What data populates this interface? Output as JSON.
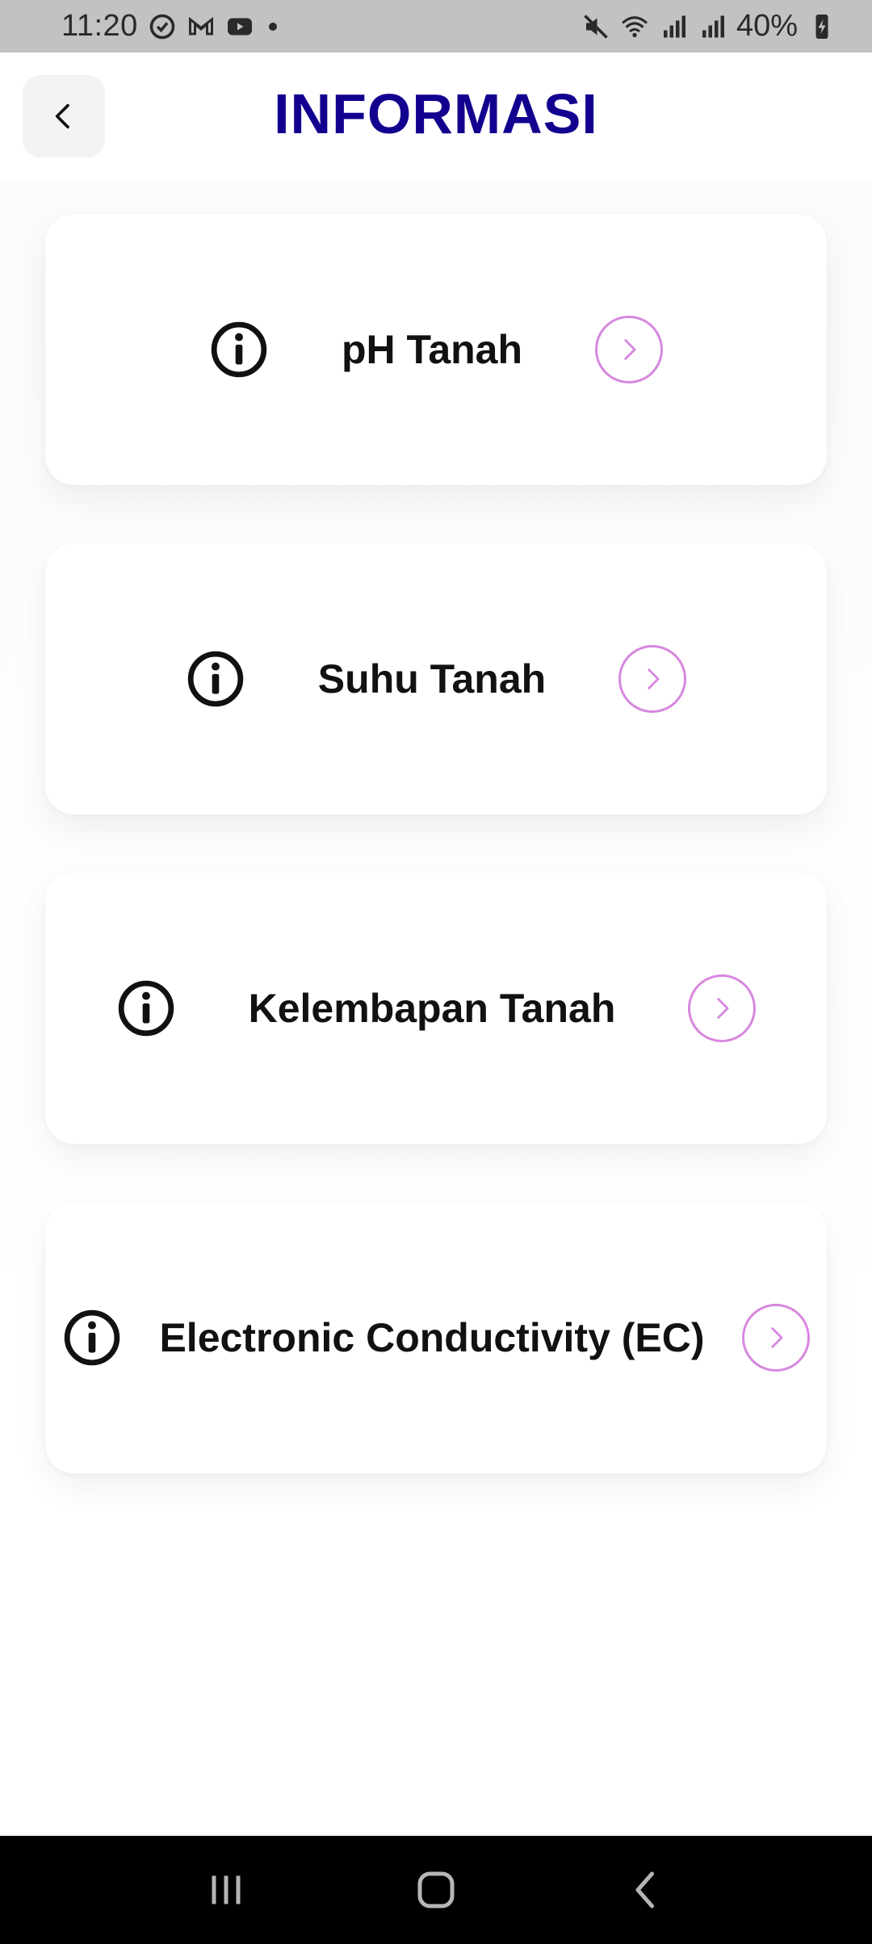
{
  "status_bar": {
    "time": "11:20",
    "battery": "40%",
    "left_icons": [
      "sync-icon",
      "gmail-icon",
      "youtube-icon",
      "dot-icon"
    ],
    "right_icons": [
      "mute-icon",
      "wifi-icon",
      "signal-icon",
      "signal-icon",
      "battery-charging-icon"
    ]
  },
  "header": {
    "title": "INFORMASI",
    "back_icon": "chevron-left-icon"
  },
  "cards": [
    {
      "label": "pH Tanah",
      "icon": "info-icon",
      "action_icon": "chevron-right-icon"
    },
    {
      "label": "Suhu Tanah",
      "icon": "info-icon",
      "action_icon": "chevron-right-icon"
    },
    {
      "label": "Kelembapan Tanah",
      "icon": "info-icon",
      "action_icon": "chevron-right-icon"
    },
    {
      "label": "Electronic Conductivity (EC)",
      "icon": "info-icon",
      "action_icon": "chevron-right-icon"
    }
  ],
  "nav_bar": {
    "buttons": [
      "recent-apps-icon",
      "home-icon",
      "back-icon"
    ]
  },
  "colors": {
    "title": "#12008f",
    "arrow_ring": "#d787df",
    "status_bar_bg": "#c2c2c2",
    "nav_bar_bg": "#000000"
  }
}
